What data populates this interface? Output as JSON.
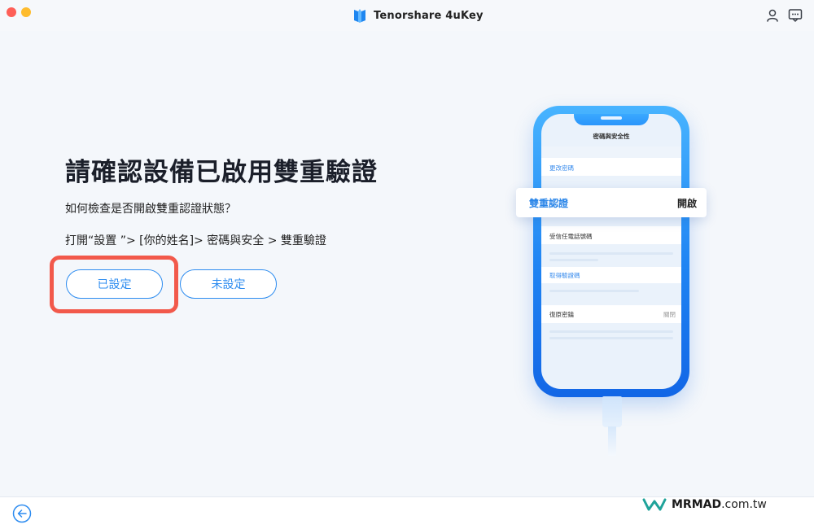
{
  "window": {
    "app_title": "Tenorshare 4uKey",
    "icons": [
      "app-logo-icon",
      "account-icon",
      "feedback-icon",
      "back-arrow-icon"
    ]
  },
  "main": {
    "heading": "請確認設備已啟用雙重驗證",
    "question": "如何檢查是否開啟雙重認證狀態？",
    "path": "打開“設置 ”> [你的姓名]> 密碼與安全 > 雙重驗證",
    "buttons": {
      "set_label": "已設定",
      "unset_label": "未設定"
    }
  },
  "phone_screen": {
    "title": "密碼與安全性",
    "change_password": "更改密碼",
    "two_factor_label": "雙重認證",
    "two_factor_value": "開啟",
    "trusted_phone": "受信任電話號碼",
    "get_code": "取得驗證碼",
    "recovery_key_label": "復原密鑰",
    "recovery_key_value": "關閉"
  },
  "watermark": {
    "brand": "MRMAD",
    "suffix": ".com.tw"
  },
  "colors": {
    "accent": "#2d8cf0",
    "highlight": "#f2594b",
    "traffic_red": "#fe5f57",
    "traffic_yellow": "#febc2e"
  }
}
